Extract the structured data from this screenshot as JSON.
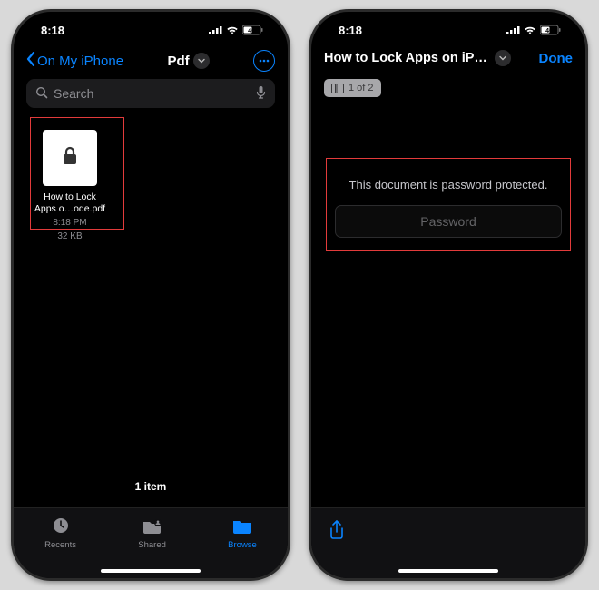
{
  "status": {
    "time": "8:18",
    "battery_badge": "46"
  },
  "screen1": {
    "back_label": "On My iPhone",
    "folder_title": "Pdf",
    "search_placeholder": "Search",
    "file": {
      "name_line1": "How to Lock",
      "name_line2": "Apps o…ode.pdf",
      "time": "8:18 PM",
      "size": "32 KB"
    },
    "footer_count": "1 item",
    "tabs": {
      "recents": "Recents",
      "shared": "Shared",
      "browse": "Browse"
    }
  },
  "screen2": {
    "doc_title": "How to Lock Apps on iPhone...",
    "done": "Done",
    "page_indicator": "1 of 2",
    "protected_msg": "This document is password protected.",
    "password_placeholder": "Password"
  }
}
